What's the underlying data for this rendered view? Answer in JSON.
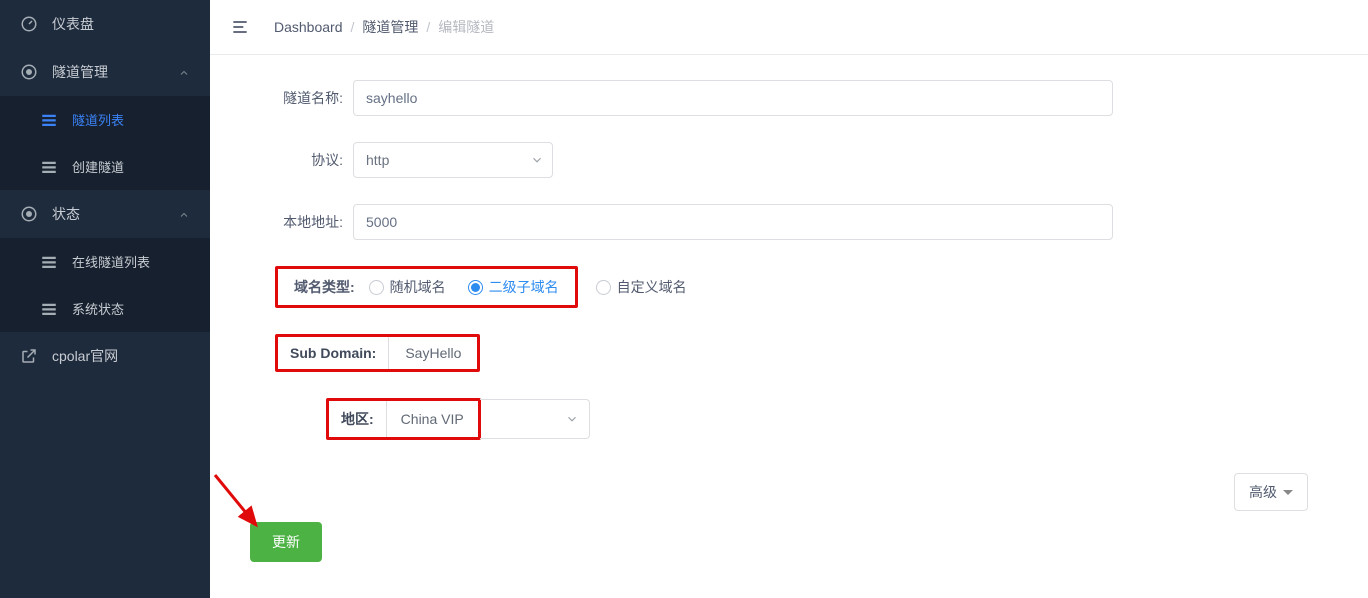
{
  "sidebar": {
    "items": [
      {
        "label": "仪表盘",
        "icon": "dashboard-icon"
      },
      {
        "label": "隧道管理",
        "icon": "tunnel-icon",
        "expanded": true,
        "children": [
          {
            "label": "隧道列表",
            "active": true
          },
          {
            "label": "创建隧道",
            "active": false
          }
        ]
      },
      {
        "label": "状态",
        "icon": "status-icon",
        "expanded": true,
        "children": [
          {
            "label": "在线隧道列表"
          },
          {
            "label": "系统状态"
          }
        ]
      },
      {
        "label": "cpolar官网",
        "icon": "external-link-icon"
      }
    ]
  },
  "breadcrumb": {
    "items": [
      "Dashboard",
      "隧道管理",
      "编辑隧道"
    ]
  },
  "form": {
    "tunnel_name_label": "隧道名称:",
    "tunnel_name_value": "sayhello",
    "protocol_label": "协议:",
    "protocol_value": "http",
    "local_addr_label": "本地地址:",
    "local_addr_value": "5000",
    "domain_type_label": "域名类型:",
    "domain_type_options": {
      "random": "随机域名",
      "subdomain": "二级子域名",
      "custom": "自定义域名"
    },
    "domain_type_selected": "subdomain",
    "sub_domain_label": "Sub Domain:",
    "sub_domain_value": "SayHello",
    "region_label": "地区:",
    "region_value": "China VIP",
    "advanced_label": "高级",
    "update_label": "更新"
  }
}
